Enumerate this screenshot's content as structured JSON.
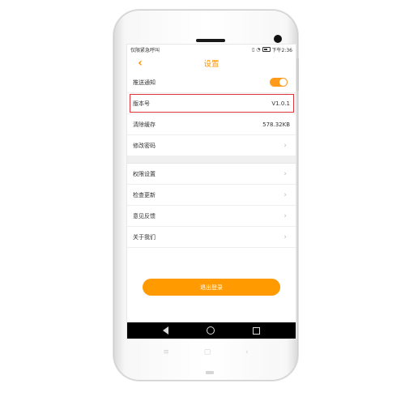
{
  "statusbar": {
    "carrier": "仅限紧急呼叫",
    "time": "下午2:36",
    "icons": [
      "vibrate-icon",
      "wifi-icon",
      "battery-icon"
    ]
  },
  "nav": {
    "title": "设置",
    "back_icon": "chevron-left-icon"
  },
  "settings": {
    "push": {
      "label": "推送通知",
      "toggle_on": true
    },
    "version": {
      "label": "版本号",
      "value": "V1.0.1"
    },
    "cache": {
      "label": "清除缓存",
      "value": "578.32KB"
    },
    "password": {
      "label": "修改密码"
    },
    "permissions": {
      "label": "权限设置"
    },
    "update": {
      "label": "检查更新"
    },
    "feedback": {
      "label": "意见反馈"
    },
    "about": {
      "label": "关于我们"
    }
  },
  "logout": {
    "label": "退出登录"
  },
  "colors": {
    "accent": "#ff9a00",
    "highlight": "#e0323a",
    "softkey_bar": "#000000"
  }
}
